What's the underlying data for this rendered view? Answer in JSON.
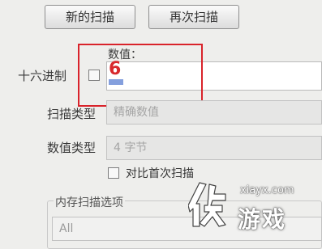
{
  "toolbar": {
    "new_scan_label": "新的扫描",
    "next_scan_label": "再次扫描"
  },
  "value": {
    "label": "数值：",
    "current": "6"
  },
  "hex": {
    "label": "十六进制",
    "checked": false
  },
  "scan_type": {
    "label": "扫描类型",
    "selected": "精确数值"
  },
  "value_type": {
    "label": "数值类型",
    "selected": "4 字节"
  },
  "compare_first": {
    "label": "对比首次扫描",
    "checked": false
  },
  "memory_options": {
    "label": "内存扫描选项",
    "selected": "All"
  },
  "watermark": {
    "site": "xiayx.com",
    "name": "游戏"
  },
  "colors": {
    "highlight": "#d9232b",
    "value_text": "#d8292d"
  }
}
